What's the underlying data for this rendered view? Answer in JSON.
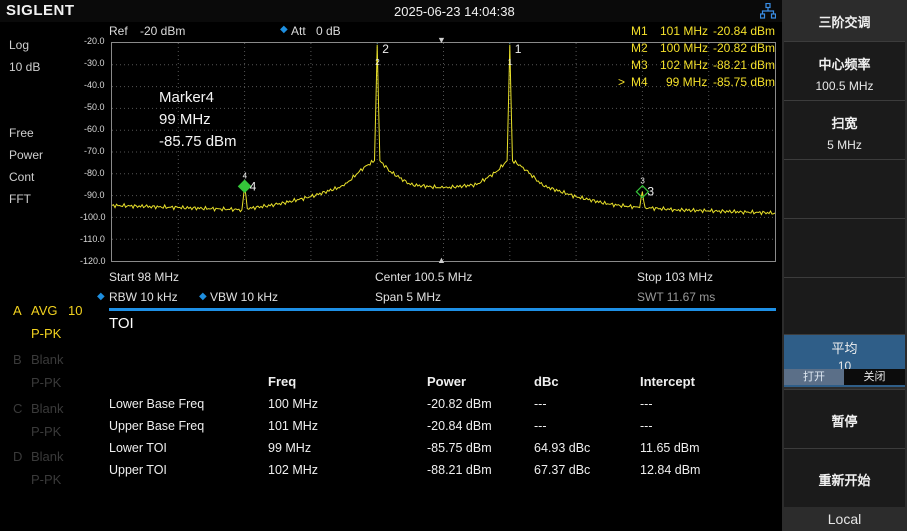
{
  "header": {
    "brand": "SIGLENT",
    "datetime": "2025-06-23 14:04:38"
  },
  "left_panel": {
    "scale_type": "Log",
    "scale_div": "10 dB",
    "mode_lines": [
      "Free",
      "Power",
      "Cont",
      "FFT"
    ],
    "traces": [
      {
        "letter": "A",
        "mode": "AVG",
        "count": "10",
        "sub": "P-PK",
        "active": true
      },
      {
        "letter": "B",
        "mode": "Blank",
        "count": "",
        "sub": "P-PK",
        "active": false
      },
      {
        "letter": "C",
        "mode": "Blank",
        "count": "",
        "sub": "P-PK",
        "active": false
      },
      {
        "letter": "D",
        "mode": "Blank",
        "count": "",
        "sub": "P-PK",
        "active": false
      }
    ]
  },
  "top_info": {
    "ref_label": "Ref",
    "ref_value": "-20 dBm",
    "att_label": "Att",
    "att_value": "0 dB"
  },
  "marker_table": [
    {
      "sel": "",
      "name": "M1",
      "freq": "101 MHz",
      "level": "-20.84 dBm"
    },
    {
      "sel": "",
      "name": "M2",
      "freq": "100 MHz",
      "level": "-20.82 dBm"
    },
    {
      "sel": "",
      "name": "M3",
      "freq": "102 MHz",
      "level": "-88.21 dBm"
    },
    {
      "sel": ">",
      "name": "M4",
      "freq": "99 MHz",
      "level": "-85.75 dBm"
    }
  ],
  "active_marker": {
    "name": "Marker4",
    "freq": "99 MHz",
    "level": "-85.75 dBm"
  },
  "chart_data": {
    "type": "line",
    "x_unit": "MHz",
    "y_unit": "dBm",
    "xlim": [
      98,
      103
    ],
    "ylim": [
      -120,
      -20
    ],
    "y_ticks": [
      "-20.0",
      "-30.0",
      "-40.0",
      "-50.0",
      "-60.0",
      "-70.0",
      "-80.0",
      "-90.0",
      "-100.0",
      "-110.0",
      "-120.0"
    ],
    "grid": true,
    "trace_color": "#e8e02a",
    "x": [
      98.0,
      98.25,
      98.5,
      98.75,
      98.98,
      99.0,
      99.02,
      99.25,
      99.5,
      99.75,
      99.9,
      99.98,
      100.0,
      100.02,
      100.1,
      100.25,
      100.5,
      100.75,
      100.9,
      100.98,
      101.0,
      101.02,
      101.1,
      101.25,
      101.5,
      101.75,
      101.98,
      102.0,
      102.02,
      102.25,
      102.5,
      102.75,
      103.0
    ],
    "y": [
      -94.5,
      -95.0,
      -95.5,
      -96.0,
      -96.5,
      -85.75,
      -96.0,
      -94.0,
      -90.5,
      -85.5,
      -77.0,
      -74.0,
      -20.82,
      -74.0,
      -79.0,
      -85.0,
      -86.5,
      -85.0,
      -79.0,
      -74.0,
      -20.84,
      -74.0,
      -77.0,
      -85.5,
      -90.5,
      -94.0,
      -95.5,
      -88.21,
      -95.5,
      -96.5,
      -97.0,
      -97.5,
      -98.0
    ],
    "markers": [
      {
        "id": "1",
        "x": 101,
        "y": -20.84
      },
      {
        "id": "2",
        "x": 100,
        "y": -20.82
      },
      {
        "id": "3",
        "x": 102,
        "y": -88.21
      },
      {
        "id": "4",
        "x": 99,
        "y": -85.75
      }
    ]
  },
  "bottom_info": {
    "start": "Start  98 MHz",
    "center": "Center  100.5 MHz",
    "stop": "Stop  103 MHz",
    "rbw": "RBW  10 kHz",
    "vbw": "VBW  10 kHz",
    "span": "Span   5 MHz",
    "swt": "SWT  11.67 ms"
  },
  "toi": {
    "title": "TOI",
    "headers": [
      "Freq",
      "Power",
      "dBc",
      "Intercept"
    ],
    "rows": [
      [
        "Lower Base Freq",
        "100 MHz",
        "-20.82 dBm",
        "---",
        "---"
      ],
      [
        "Upper Base Freq",
        "101 MHz",
        "-20.84 dBm",
        "---",
        "---"
      ],
      [
        "Lower TOI",
        "99 MHz",
        "-85.75 dBm",
        "64.93 dBc",
        "11.65 dBm"
      ],
      [
        "Upper TOI",
        "102 MHz",
        "-88.21 dBm",
        "67.37 dBc",
        "12.84 dBm"
      ]
    ]
  },
  "right_menu": {
    "title": "三阶交调",
    "center_label": "中心频率",
    "center_value": "100.5 MHz",
    "span_label": "扫宽",
    "span_value": "5 MHz",
    "avg_label": "平均",
    "avg_value": "10",
    "avg_on": "打开",
    "avg_off": "关闭",
    "pause": "暂停",
    "restart": "重新开始",
    "local": "Local"
  }
}
